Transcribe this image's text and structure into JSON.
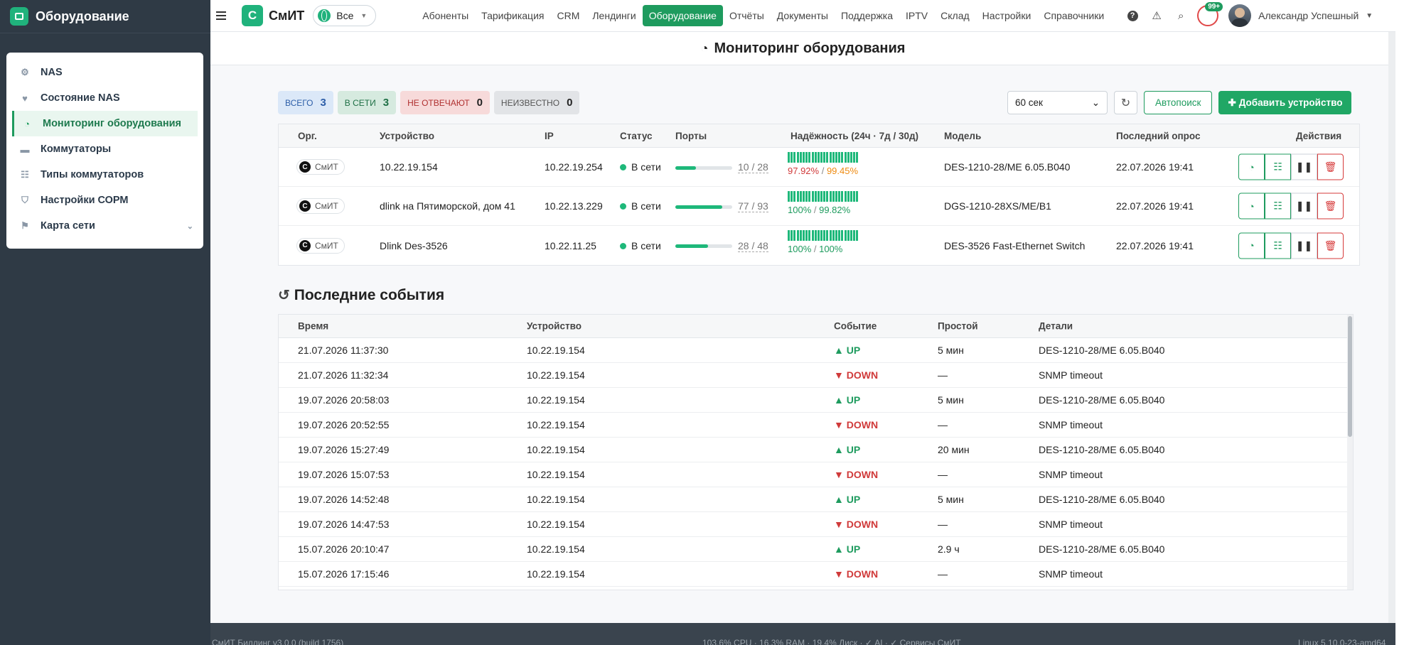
{
  "sidebar": {
    "title": "Оборудование",
    "items": [
      {
        "label": "NAS",
        "icon": "network-icon",
        "glyph": "⚙"
      },
      {
        "label": "Состояние NAS",
        "icon": "heart-icon",
        "glyph": "♥"
      },
      {
        "label": "Мониторинг оборудования",
        "icon": "satellite-dish-icon",
        "glyph": "◔",
        "active": true
      },
      {
        "label": "Коммутаторы",
        "icon": "switch-icon",
        "glyph": "▬"
      },
      {
        "label": "Типы коммутаторов",
        "icon": "sitemap-icon",
        "glyph": "☷"
      },
      {
        "label": "Настройки СОРМ",
        "icon": "shield-icon",
        "glyph": "⛉"
      },
      {
        "label": "Карта сети",
        "icon": "map-icon",
        "glyph": "⚑"
      }
    ]
  },
  "topbar": {
    "brand_letter": "С",
    "brand": "СмИТ",
    "org_select": "Все",
    "nav": [
      "Абоненты",
      "Тарификация",
      "CRM",
      "Лендинги",
      "Оборудование",
      "Отчёты",
      "Документы",
      "Поддержка",
      "IPTV",
      "Склад",
      "Настройки",
      "Справочники"
    ],
    "nav_active": "Оборудование",
    "notifications": "99+",
    "user": "Александр Успешный"
  },
  "page": {
    "title": "Мониторинг оборудования"
  },
  "stats": [
    {
      "label": "ВСЕГО",
      "value": "3"
    },
    {
      "label": "В СЕТИ",
      "value": "3"
    },
    {
      "label": "НЕ ОТВЕЧАЮТ",
      "value": "0"
    },
    {
      "label": "НЕИЗВЕСТНО",
      "value": "0"
    }
  ],
  "controls": {
    "interval": "60 сек",
    "autosearch": "Автопоиск",
    "add_device": "Добавить устройство"
  },
  "devices": {
    "headers": [
      "Орг.",
      "Устройство",
      "IP",
      "Статус",
      "Порты",
      "Надёжность (24ч · 7д / 30д)",
      "Модель",
      "Последний опрос",
      "Действия"
    ],
    "rows": [
      {
        "org": "СмИТ",
        "name": "10.22.19.154",
        "ip": "10.22.19.254",
        "status": "В сети",
        "ports": "10 / 28",
        "ports_fraction": 0.36,
        "rel_24": "97.92%",
        "rel_7": "99.45%",
        "rel_24_color": "#d03a3a",
        "rel_7_color": "#ee8a10",
        "model": "DES-1210-28/ME 6.05.B040",
        "polled": "22.07.2026 19:41"
      },
      {
        "org": "СмИТ",
        "name": "dlink на Пятиморской, дом 41",
        "ip": "10.22.13.229",
        "status": "В сети",
        "ports": "77 / 93",
        "ports_fraction": 0.83,
        "rel_24": "100%",
        "rel_7": "99.82%",
        "rel_24_color": "#1e9b5e",
        "rel_7_color": "#1e9b5e",
        "model": "DGS-1210-28XS/ME/B1",
        "polled": "22.07.2026 19:41"
      },
      {
        "org": "СмИТ",
        "name": "Dlink Des-3526",
        "ip": "10.22.11.25",
        "status": "В сети",
        "ports": "28 / 48",
        "ports_fraction": 0.58,
        "rel_24": "100%",
        "rel_7": "100%",
        "rel_24_color": "#1e9b5e",
        "rel_7_color": "#1e9b5e",
        "model": "DES-3526 Fast-Ethernet Switch",
        "polled": "22.07.2026 19:41"
      }
    ]
  },
  "events": {
    "title": "Последние события",
    "headers": [
      "Время",
      "Устройство",
      "Событие",
      "Простой",
      "Детали"
    ],
    "rows": [
      {
        "time": "21.07.2026 11:37:30",
        "device": "10.22.19.154",
        "event": "UP",
        "downtime": "5 мин",
        "details": "DES-1210-28/ME 6.05.B040"
      },
      {
        "time": "21.07.2026 11:32:34",
        "device": "10.22.19.154",
        "event": "DOWN",
        "downtime": "—",
        "details": "SNMP timeout"
      },
      {
        "time": "19.07.2026 20:58:03",
        "device": "10.22.19.154",
        "event": "UP",
        "downtime": "5 мин",
        "details": "DES-1210-28/ME 6.05.B040"
      },
      {
        "time": "19.07.2026 20:52:55",
        "device": "10.22.19.154",
        "event": "DOWN",
        "downtime": "—",
        "details": "SNMP timeout"
      },
      {
        "time": "19.07.2026 15:27:49",
        "device": "10.22.19.154",
        "event": "UP",
        "downtime": "20 мин",
        "details": "DES-1210-28/ME 6.05.B040"
      },
      {
        "time": "19.07.2026 15:07:53",
        "device": "10.22.19.154",
        "event": "DOWN",
        "downtime": "—",
        "details": "SNMP timeout"
      },
      {
        "time": "19.07.2026 14:52:48",
        "device": "10.22.19.154",
        "event": "UP",
        "downtime": "5 мин",
        "details": "DES-1210-28/ME 6.05.B040"
      },
      {
        "time": "19.07.2026 14:47:53",
        "device": "10.22.19.154",
        "event": "DOWN",
        "downtime": "—",
        "details": "SNMP timeout"
      },
      {
        "time": "15.07.2026 20:10:47",
        "device": "10.22.19.154",
        "event": "UP",
        "downtime": "2.9 ч",
        "details": "DES-1210-28/ME 6.05.B040"
      },
      {
        "time": "15.07.2026 17:15:46",
        "device": "10.22.19.154",
        "event": "DOWN",
        "downtime": "—",
        "details": "SNMP timeout"
      }
    ]
  },
  "footer": {
    "left": "СмИТ Биллинг v3.0.0 (build 1756)",
    "center": "103.6% CPU · 16.3% RAM · 19.4% Диск · ✓ AI · ✓ Сервисы СмИТ",
    "right": "Linux 5.10.0-23-amd64"
  }
}
